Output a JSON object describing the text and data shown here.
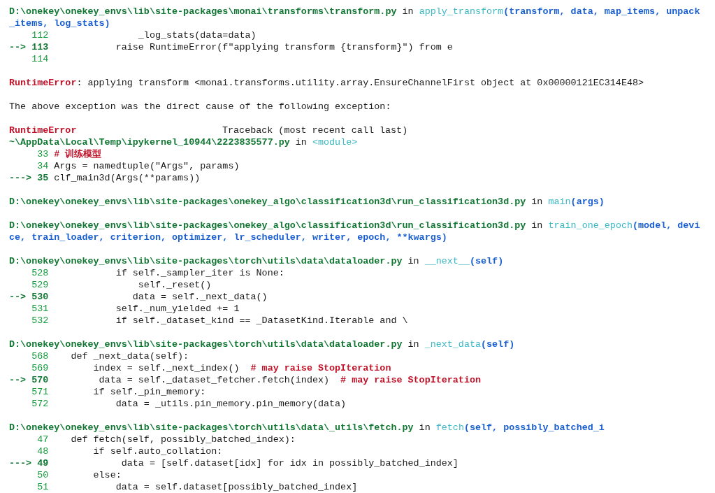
{
  "traceback": [
    {
      "kind": "file",
      "path": "D:\\onekey\\onekey_envs\\lib\\site-packages\\monai\\transforms\\transform.py",
      "joiner": "in",
      "func": "apply_transform",
      "args": "(transform, data, map_items, unpack_items, log_stats)"
    },
    {
      "kind": "code",
      "current": false,
      "lineno": "    112",
      "code": "                _log_stats(data=data)"
    },
    {
      "kind": "code",
      "current": true,
      "lineno": "--> 113",
      "code": "            raise RuntimeError(f\"applying transform {transform}\") from e"
    },
    {
      "kind": "code",
      "current": false,
      "lineno": "    114"
    },
    {
      "kind": "blank"
    },
    {
      "kind": "error",
      "name": "RuntimeError",
      "message": ": applying transform <monai.transforms.utility.array.EnsureChannelFirst object at 0x00000121EC314E48>"
    },
    {
      "kind": "blank"
    },
    {
      "kind": "text",
      "text": "The above exception was the direct cause of the following exception:"
    },
    {
      "kind": "blank"
    },
    {
      "kind": "header",
      "name": "RuntimeError",
      "title": "Traceback (most recent call last)"
    },
    {
      "kind": "file",
      "path": "~\\AppData\\Local\\Temp\\ipykernel_10944\\2223835577.py",
      "joiner": "in",
      "func": "<module>"
    },
    {
      "kind": "code",
      "current": false,
      "lineno": "     33",
      "comment": "# 训练模型"
    },
    {
      "kind": "code",
      "current": false,
      "lineno": "     34",
      "code": " Args = namedtuple(\"Args\", params)"
    },
    {
      "kind": "code",
      "current": true,
      "lineno": "---> 35",
      "code": " clf_main3d(Args(**params))"
    },
    {
      "kind": "blank"
    },
    {
      "kind": "file",
      "path": "D:\\onekey\\onekey_envs\\lib\\site-packages\\onekey_algo\\classification3d\\run_classification3d.py",
      "joiner": "in",
      "func": "main",
      "args": "(args)"
    },
    {
      "kind": "blank"
    },
    {
      "kind": "file",
      "path": "D:\\onekey\\onekey_envs\\lib\\site-packages\\onekey_algo\\classification3d\\run_classification3d.py",
      "joiner": "in",
      "func": "train_one_epoch",
      "args": "(model, device, train_loader, criterion, optimizer, lr_scheduler, writer, epoch, **kwargs)"
    },
    {
      "kind": "blank"
    },
    {
      "kind": "file",
      "path": "D:\\onekey\\onekey_envs\\lib\\site-packages\\torch\\utils\\data\\dataloader.py",
      "joiner": "in",
      "func": "__next__",
      "args": "(self)"
    },
    {
      "kind": "code",
      "current": false,
      "lineno": "    528",
      "code": "            if self._sampler_iter is None:"
    },
    {
      "kind": "code",
      "current": false,
      "lineno": "    529",
      "code": "                self._reset()"
    },
    {
      "kind": "code",
      "current": true,
      "lineno": "--> 530",
      "code": "               data = self._next_data()"
    },
    {
      "kind": "code",
      "current": false,
      "lineno": "    531",
      "code": "            self._num_yielded += 1"
    },
    {
      "kind": "code",
      "current": false,
      "lineno": "    532",
      "code": "            if self._dataset_kind == _DatasetKind.Iterable and \\"
    },
    {
      "kind": "blank"
    },
    {
      "kind": "file",
      "path": "D:\\onekey\\onekey_envs\\lib\\site-packages\\torch\\utils\\data\\dataloader.py",
      "joiner": "in",
      "func": "_next_data",
      "args": "(self)"
    },
    {
      "kind": "code",
      "current": false,
      "lineno": "    568",
      "code": "    def _next_data(self):"
    },
    {
      "kind": "code",
      "current": false,
      "lineno": "    569",
      "code": "        index = self._next_index()  ",
      "comment": "# may raise StopIteration"
    },
    {
      "kind": "code",
      "current": true,
      "lineno": "--> 570",
      "code": "         data = self._dataset_fetcher.fetch(index)  ",
      "comment": "# may raise StopIteration"
    },
    {
      "kind": "code",
      "current": false,
      "lineno": "    571",
      "code": "        if self._pin_memory:"
    },
    {
      "kind": "code",
      "current": false,
      "lineno": "    572",
      "code": "            data = _utils.pin_memory.pin_memory(data)"
    },
    {
      "kind": "blank"
    },
    {
      "kind": "file",
      "path": "D:\\onekey\\onekey_envs\\lib\\site-packages\\torch\\utils\\data\\_utils\\fetch.py",
      "joiner": "in",
      "func": "fetch",
      "args": "(self, possibly_batched_i"
    },
    {
      "kind": "code",
      "current": false,
      "lineno": "     47",
      "code": "    def fetch(self, possibly_batched_index):"
    },
    {
      "kind": "code",
      "current": false,
      "lineno": "     48",
      "code": "        if self.auto_collation:"
    },
    {
      "kind": "code",
      "current": true,
      "lineno": "---> 49",
      "code": "             data = [self.dataset[idx] for idx in possibly_batched_index]"
    },
    {
      "kind": "code",
      "current": false,
      "lineno": "     50",
      "code": "        else:"
    },
    {
      "kind": "code",
      "current": false,
      "lineno": "     51",
      "code": "            data = self.dataset[possibly_batched_index]"
    }
  ]
}
